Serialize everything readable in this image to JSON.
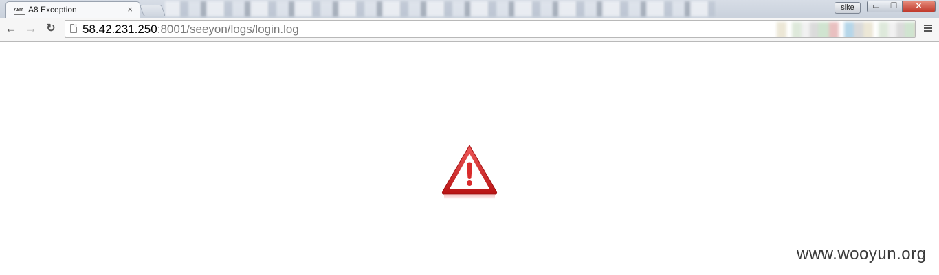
{
  "tab": {
    "favicon_text": "A8m",
    "title": "A8 Exception",
    "close_glyph": "×"
  },
  "window": {
    "profile_name": "sike",
    "minimize_glyph": "▭",
    "maximize_glyph": "❐",
    "close_glyph": "✕"
  },
  "toolbar": {
    "back_glyph": "←",
    "forward_glyph": "→",
    "reload_glyph": "↻",
    "url_host": "58.42.231.250",
    "url_rest": ":8001/seeyon/logs/login.log"
  },
  "page": {
    "icon": "warning-triangle-icon",
    "accent_color": "#d92b2b",
    "watermark": "www.wooyun.org"
  }
}
